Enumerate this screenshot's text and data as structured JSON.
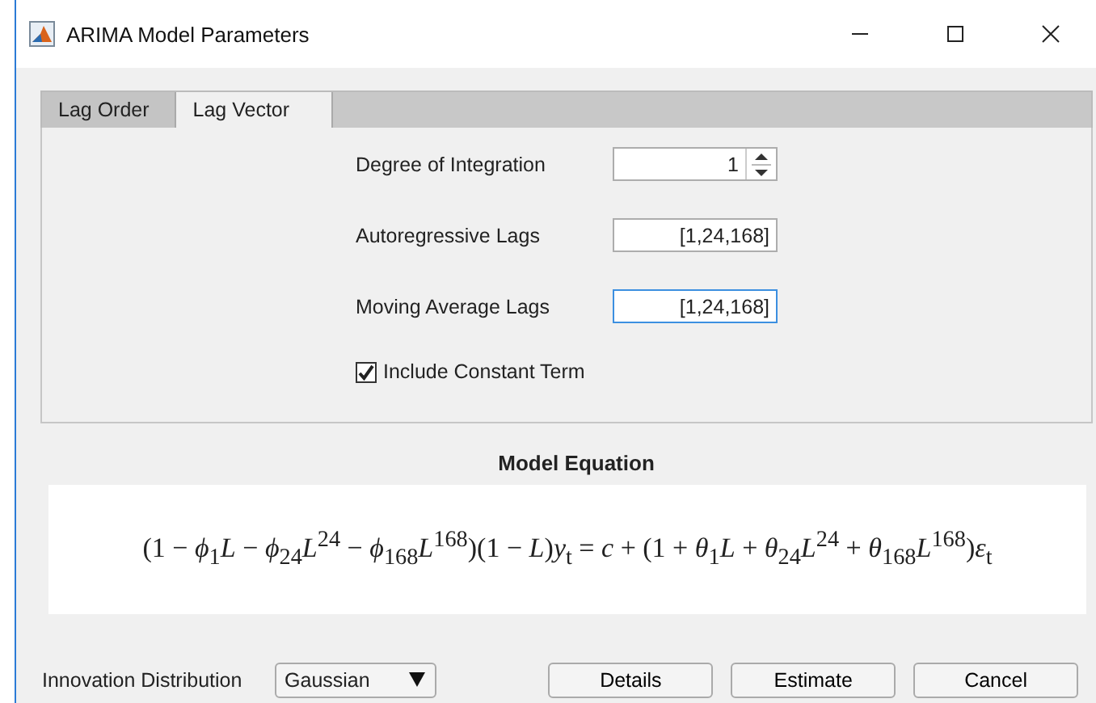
{
  "window": {
    "title": "ARIMA Model Parameters"
  },
  "tabs": [
    {
      "label": "Lag Order",
      "selected": false
    },
    {
      "label": "Lag Vector",
      "selected": true
    }
  ],
  "fields": [
    {
      "kind": "spinner",
      "label": "Degree of Integration",
      "value": "1",
      "focused": false
    },
    {
      "kind": "text",
      "label": "Autoregressive Lags",
      "value": "[1,24,168]",
      "focused": false
    },
    {
      "kind": "text",
      "label": "Moving Average Lags",
      "value": "[1,24,168]",
      "focused": true
    }
  ],
  "constant_term": {
    "label": "Include Constant Term",
    "checked": true
  },
  "equation": {
    "heading": "Model Equation",
    "formula": "(1 − *ϕ*$_{1}$*L* − *ϕ*$_{24}$*L*$^{24}$ − *ϕ*$_{168}$*L*$^{168}$)(1 − *L*)*y*$_{t}$ = *c* + (1 + *θ*$_{1}$*L* + *θ*$_{24}$*L*$^{24}$ + *θ*$_{168}$*L*$^{168}$)*ε*$_{t}$"
  },
  "distribution": {
    "label": "Innovation Distribution",
    "value": "Gaussian"
  },
  "buttons": [
    "Details",
    "Estimate",
    "Cancel"
  ]
}
